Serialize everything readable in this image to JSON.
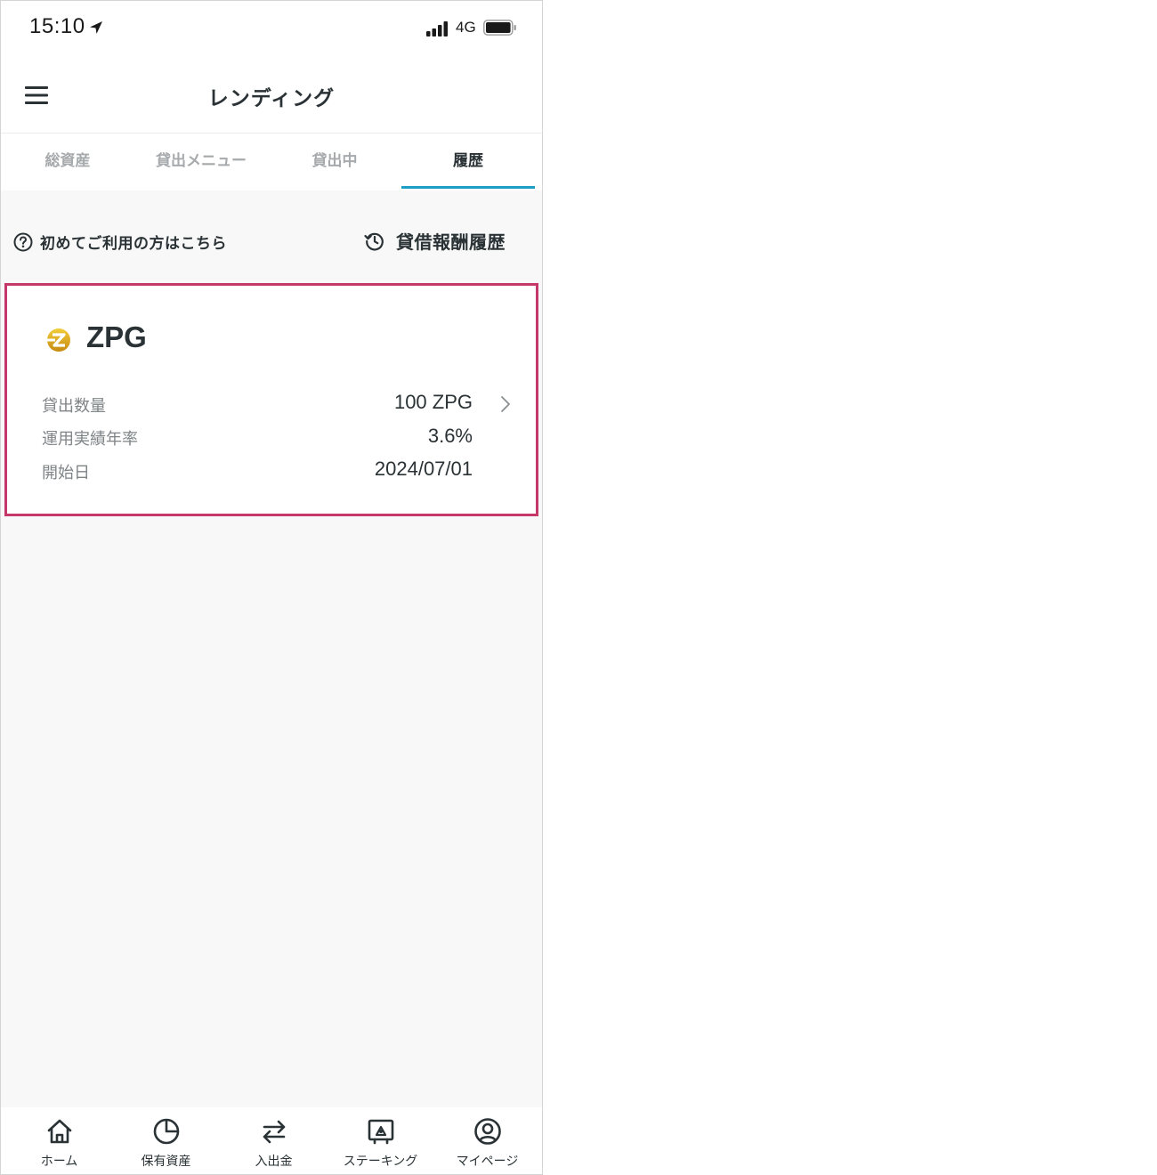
{
  "status_bar": {
    "time": "15:10",
    "network": "4G",
    "icons": [
      "location-arrow-icon",
      "signal-icon",
      "battery-icon"
    ]
  },
  "header": {
    "title": "レンディング",
    "menu_icon": "hamburger-menu-icon"
  },
  "tabs": [
    {
      "label": "総資産",
      "active": false
    },
    {
      "label": "貸出メニュー",
      "active": false
    },
    {
      "label": "貸出中",
      "active": false
    },
    {
      "label": "履歴",
      "active": true
    }
  ],
  "links": {
    "guide": {
      "label": "初めてご利用の方はこちら",
      "icon": "question-circle-icon"
    },
    "reward_history": {
      "label": "貸借報酬履歴",
      "icon": "history-clock-icon"
    }
  },
  "card": {
    "coin_name": "ZPG",
    "coin_icon": "zpg-coin-icon",
    "rows": [
      {
        "label": "貸出数量",
        "value": "100 ZPG"
      },
      {
        "label": "運用実績年率",
        "value": "3.6%"
      },
      {
        "label": "開始日",
        "value": "2024/07/01"
      }
    ],
    "highlight_color": "#c4386a"
  },
  "bottom_nav": [
    {
      "label": "ホーム",
      "icon": "home-icon"
    },
    {
      "label": "保有資産",
      "icon": "pie-chart-icon"
    },
    {
      "label": "入出金",
      "icon": "transfer-arrows-icon"
    },
    {
      "label": "ステーキング",
      "icon": "safe-icon"
    },
    {
      "label": "マイページ",
      "icon": "user-circle-icon"
    }
  ],
  "colors": {
    "accent": "#1c9fc4",
    "text_primary": "#2a3235",
    "text_secondary": "#7f8487",
    "tab_inactive": "#a7aaac",
    "background": "#f8f8f8"
  }
}
